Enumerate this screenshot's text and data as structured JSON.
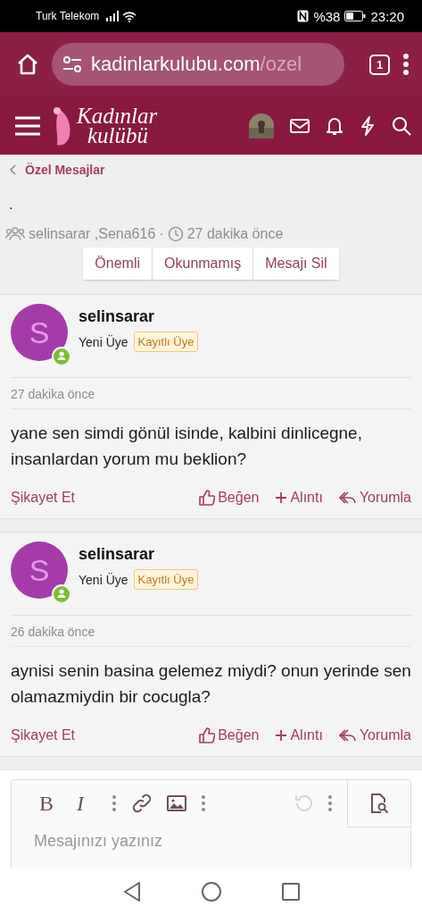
{
  "status_bar": {
    "carrier": "Turk Telekom",
    "battery": "%38",
    "time": "23:20"
  },
  "browser": {
    "url_host": "kadinlarkulubu.com",
    "url_path": "/ozel",
    "tab_count": "1"
  },
  "site_header": {
    "logo_line1": "Kadınlar",
    "logo_line2": "kulübü"
  },
  "breadcrumb": {
    "label": "Özel Mesajlar"
  },
  "conversation": {
    "title": ".",
    "participants": "selinsarar ,Sena616",
    "separator": "·",
    "time": "27 dakika önce",
    "actions": [
      {
        "label": "Önemli"
      },
      {
        "label": "Okunmamış"
      },
      {
        "label": "Mesajı Sil"
      }
    ]
  },
  "messages": [
    {
      "avatar_letter": "S",
      "author": "selinsarar",
      "title": "Yeni Üye",
      "badge": "Kayıtlı Üye",
      "online": true,
      "time": "27 dakika önce",
      "text": "yane sen simdi gönül isinde, kalbini dinlicegne, insanlardan yorum mu beklion?",
      "report": "Şikayet Et",
      "like": "Beğen",
      "quote": "Alıntı",
      "reply": "Yorumla"
    },
    {
      "avatar_letter": "S",
      "author": "selinsarar",
      "title": "Yeni Üye",
      "badge": "Kayıtlı Üye",
      "online": true,
      "time": "26 dakika önce",
      "text": "aynisi senin basina gelemez miydi? onun yerinde sen olamazmiydin bir cocugla?",
      "report": "Şikayet Et",
      "like": "Beğen",
      "quote": "Alıntı",
      "reply": "Yorumla"
    }
  ],
  "editor": {
    "bold_label": "B",
    "italic_label": "I",
    "undo_disabled": true,
    "placeholder": "Mesajınızı yazınız"
  }
}
